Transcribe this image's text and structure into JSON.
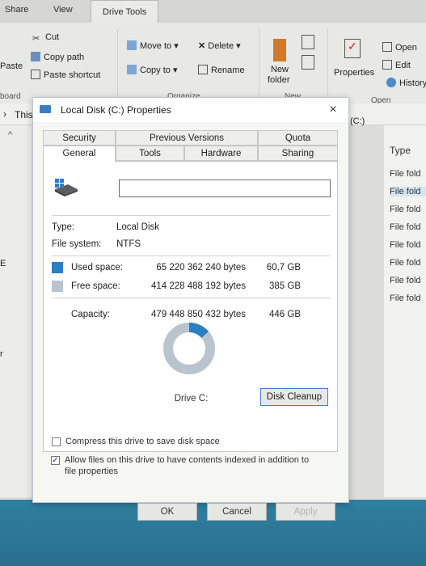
{
  "ribbon": {
    "tabs": [
      "Share",
      "View",
      "Drive Tools"
    ],
    "clipboard": {
      "cut": "Cut",
      "copy_path": "Copy path",
      "paste": "Paste",
      "paste_shortcut": "Paste shortcut",
      "group": "board"
    },
    "organize": {
      "move_to": "Move to",
      "copy_to": "Copy to",
      "delete": "Delete",
      "rename": "Rename",
      "group": "Organize"
    },
    "new": {
      "new_folder_1": "New",
      "new_folder_2": "folder",
      "group": "New"
    },
    "open": {
      "properties": "Properties",
      "open": "Open",
      "edit": "Edit",
      "history": "History",
      "group": "Open"
    }
  },
  "nav": {
    "path": "This",
    "drive_crumb": "(C:)"
  },
  "file_list": {
    "header": "Type",
    "rows": [
      "File fold",
      "File fold",
      "File fold",
      "File fold",
      "File fold",
      "File fold",
      "File fold",
      "File fold"
    ]
  },
  "left_pane": {
    "frag1": "E",
    "frag2": "r"
  },
  "dialog": {
    "title": "Local Disk (C:) Properties",
    "close": "×",
    "tabs_top": [
      "Security",
      "Previous Versions",
      "Quota"
    ],
    "tabs_bottom": [
      "General",
      "Tools",
      "Hardware",
      "Sharing"
    ],
    "name_value": "",
    "type_label": "Type:",
    "type_value": "Local Disk",
    "fs_label": "File system:",
    "fs_value": "NTFS",
    "used_label": "Used space:",
    "used_bytes": "65 220 362 240 bytes",
    "used_gb": "60,7 GB",
    "free_label": "Free space:",
    "free_bytes": "414 228 488 192 bytes",
    "free_gb": "385 GB",
    "cap_label": "Capacity:",
    "cap_bytes": "479 448 850 432 bytes",
    "cap_gb": "446 GB",
    "used_fraction": 0.136,
    "drive_label": "Drive C:",
    "cleanup": "Disk Cleanup",
    "compress_label": "Compress this drive to save disk space",
    "compress_checked": false,
    "index_label_1": "Allow files on this drive to have contents indexed in addition to",
    "index_label_2": "file properties",
    "index_checked": true,
    "ok": "OK",
    "cancel": "Cancel",
    "apply": "Apply",
    "colors": {
      "used": "#2b7fc3",
      "free": "#b9c4ce"
    }
  }
}
